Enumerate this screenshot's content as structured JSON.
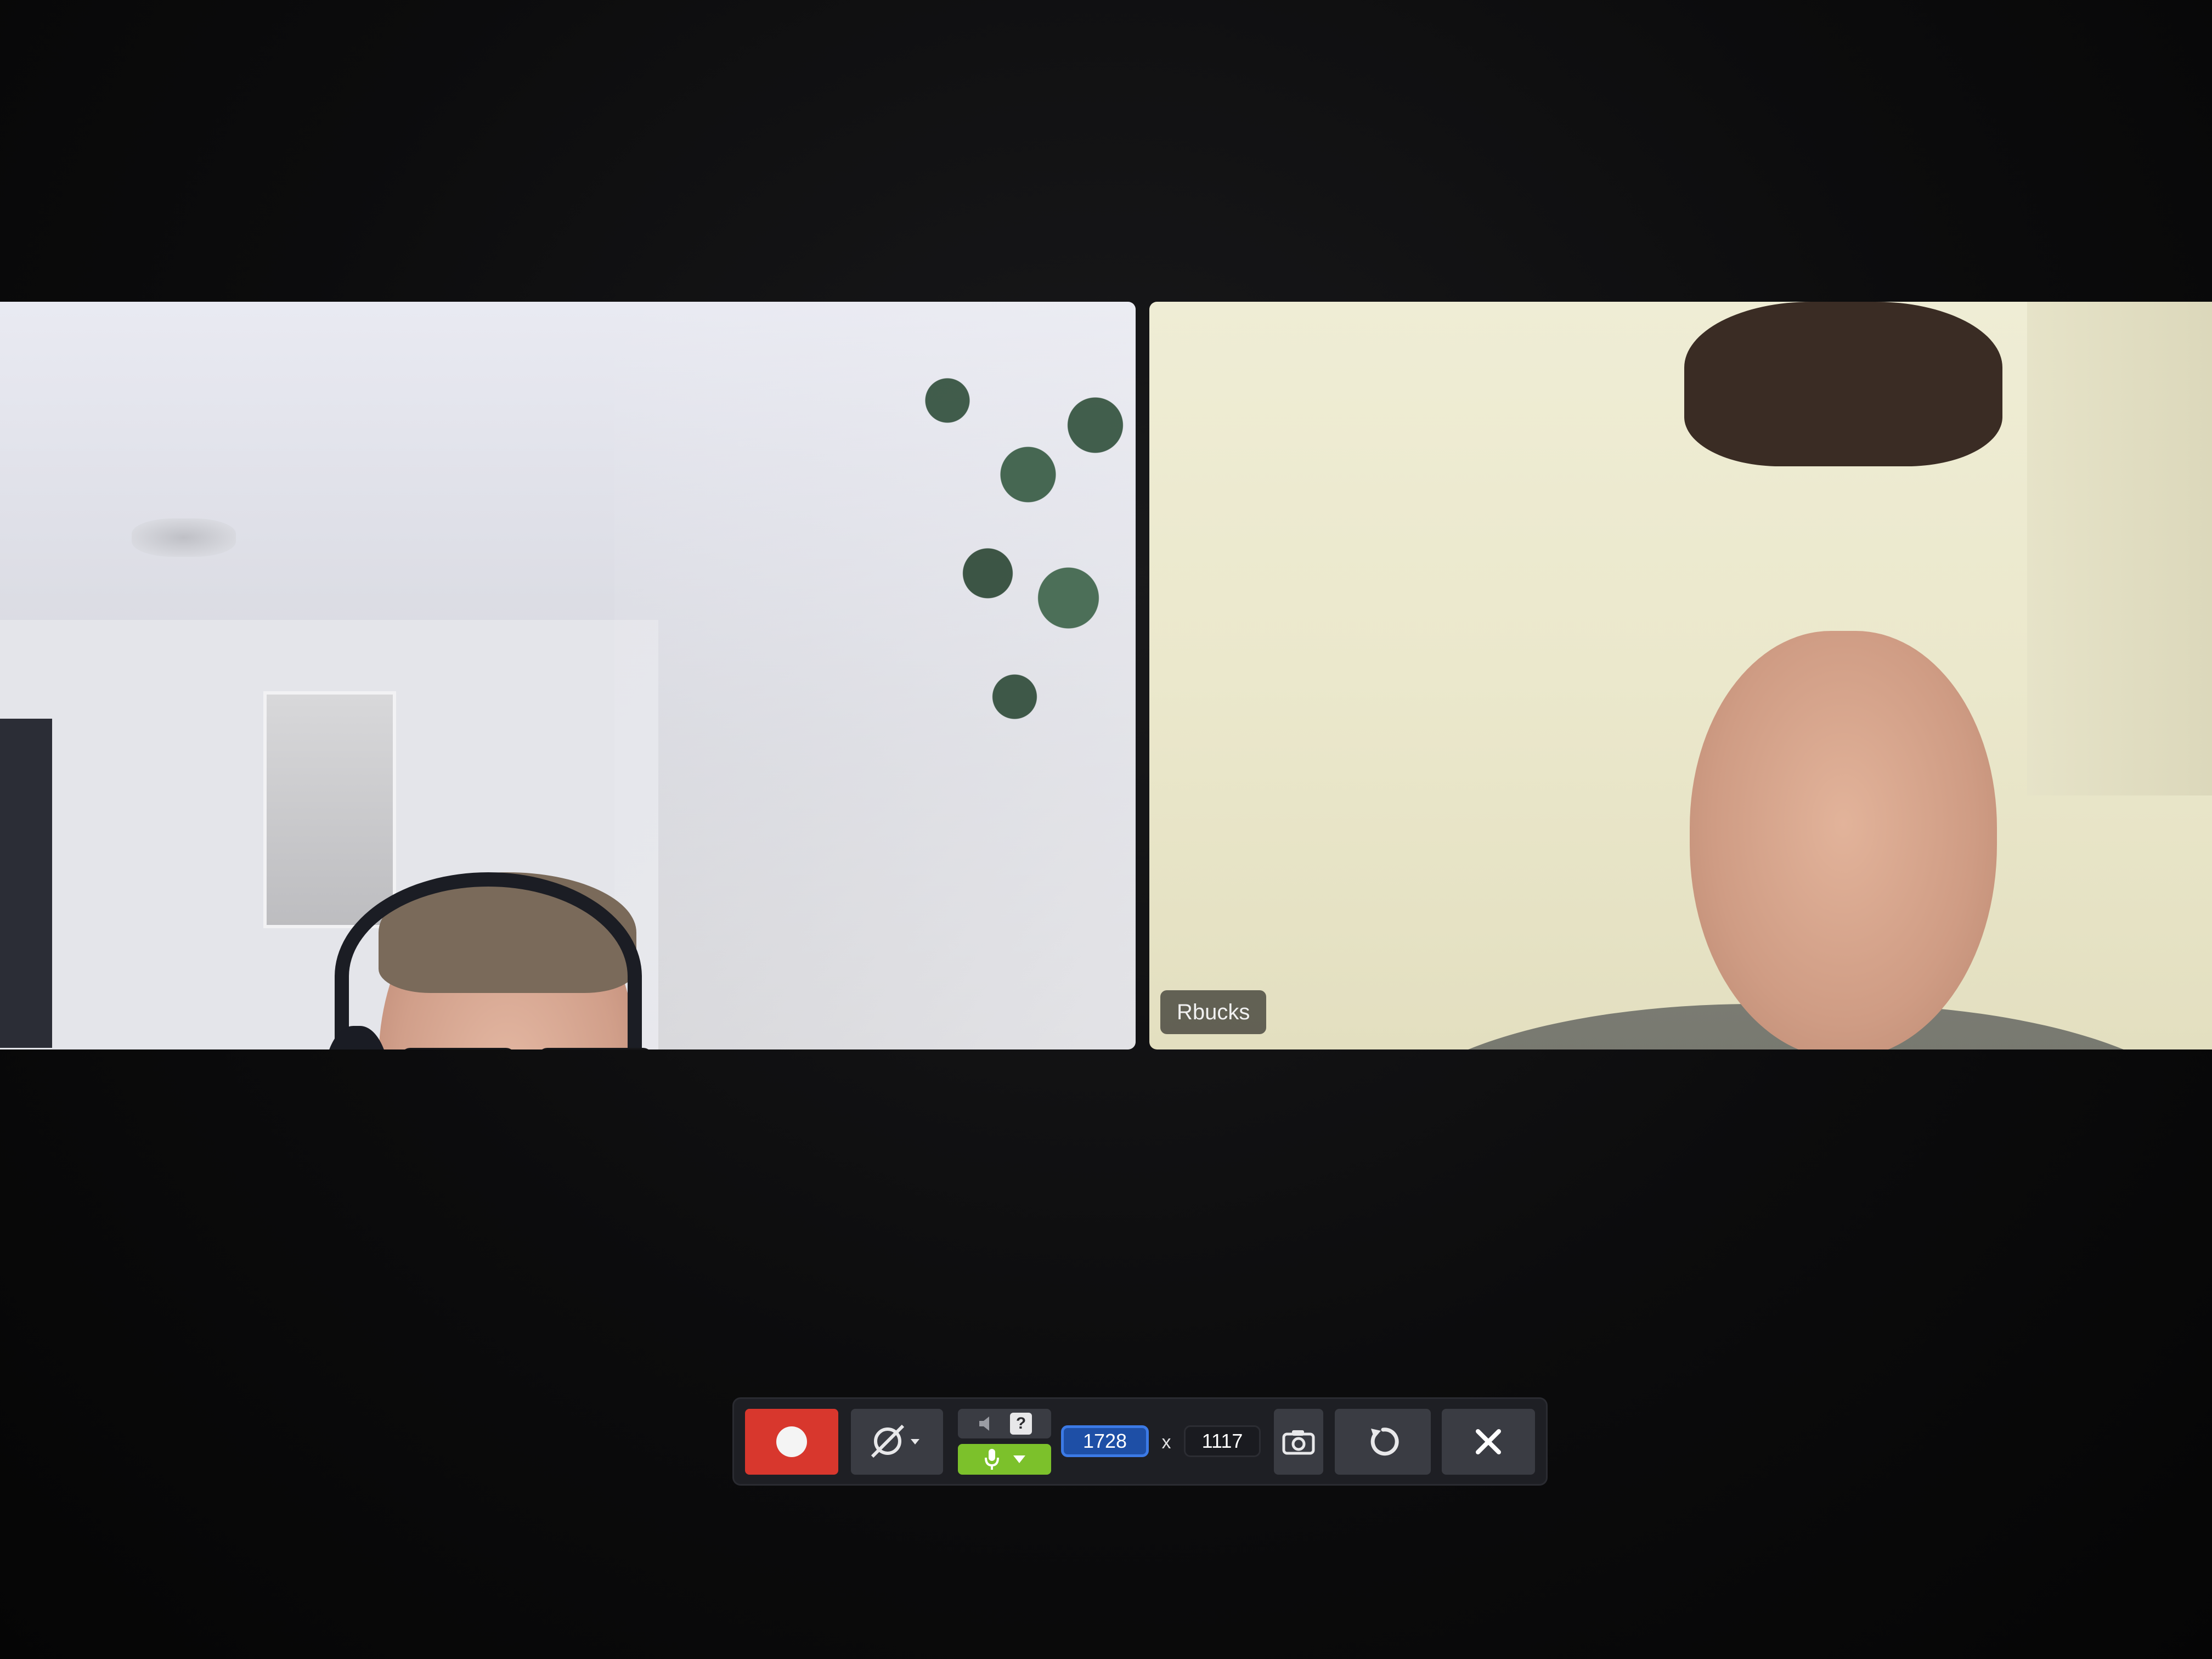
{
  "tiles": {
    "left": {},
    "right": {
      "name": "Rbucks"
    }
  },
  "toolbar": {
    "record_icon": "record-icon",
    "camera_icon": "camera-off-icon",
    "speaker_icon": "speaker-icon",
    "help_label": "?",
    "mic_icon": "microphone-icon",
    "width_value": "1728",
    "times_label": "x",
    "height_value": "1117",
    "snapshot_icon": "camera-icon",
    "reset_icon": "reset-icon",
    "close_icon": "close-icon",
    "colors": {
      "record": "#d8372d",
      "mic_active": "#7cc12b",
      "width_field": "#1e4fa6"
    }
  }
}
